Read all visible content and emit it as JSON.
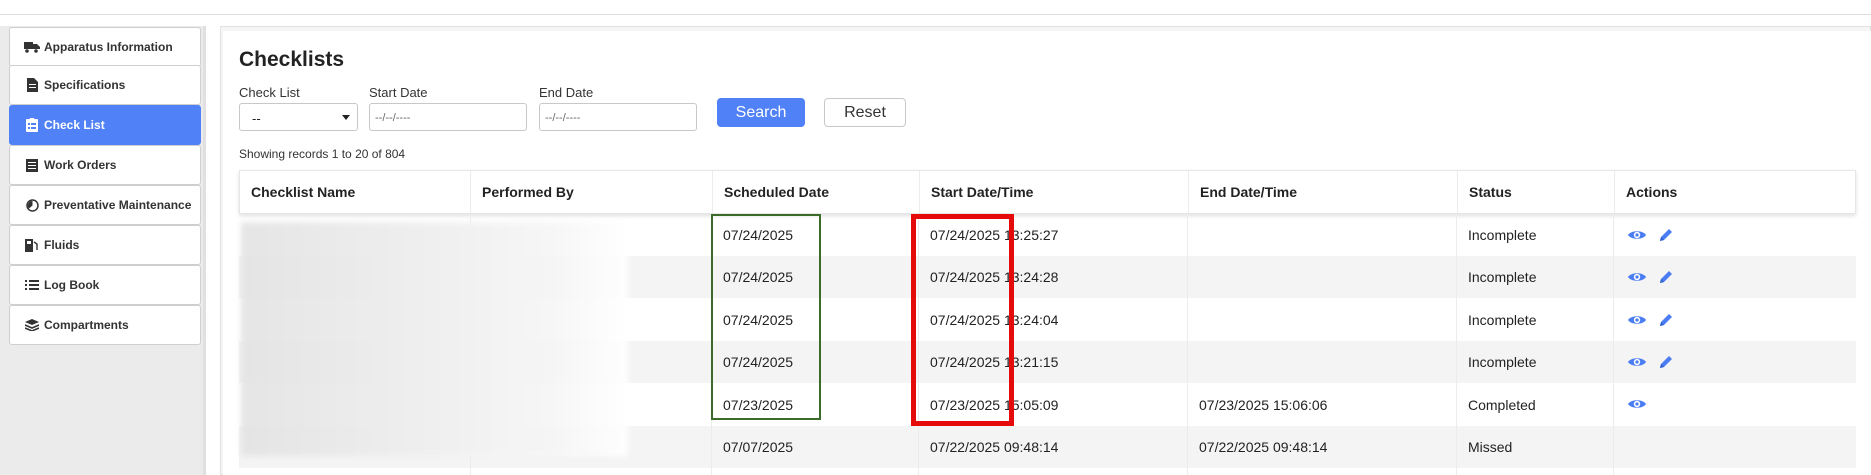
{
  "sidebar": {
    "items": [
      {
        "label": "Apparatus Information",
        "icon": "truck-icon",
        "active": false
      },
      {
        "label": "Specifications",
        "icon": "document-icon",
        "active": false
      },
      {
        "label": "Check List",
        "icon": "clipboard-icon",
        "active": true
      },
      {
        "label": "Work Orders",
        "icon": "list-box-icon",
        "active": false
      },
      {
        "label": "Preventative Maintenance",
        "icon": "gauge-icon",
        "active": false
      },
      {
        "label": "Fluids",
        "icon": "fuel-icon",
        "active": false
      },
      {
        "label": "Log Book",
        "icon": "list-icon",
        "active": false
      },
      {
        "label": "Compartments",
        "icon": "layers-icon",
        "active": false
      }
    ]
  },
  "main": {
    "title": "Checklists",
    "filters": {
      "checklist_label": "Check List",
      "checklist_value": "--",
      "start_label": "Start Date",
      "start_placeholder": "--/--/----",
      "end_label": "End Date",
      "end_placeholder": "--/--/----"
    },
    "search_label": "Search",
    "reset_label": "Reset",
    "records_text": "Showing records 1 to 20 of 804",
    "table": {
      "columns": [
        "Checklist Name",
        "Performed By",
        "Scheduled Date",
        "Start Date/Time",
        "End Date/Time",
        "Status",
        "Actions"
      ],
      "rows": [
        {
          "name": "",
          "performed_by": "",
          "scheduled": "07/24/2025",
          "start": "07/24/2025 13:25:27",
          "end": "",
          "status": "Incomplete",
          "actions": [
            "view-icon",
            "edit-icon"
          ]
        },
        {
          "name": "",
          "performed_by": "",
          "scheduled": "07/24/2025",
          "start": "07/24/2025 13:24:28",
          "end": "",
          "status": "Incomplete",
          "actions": [
            "view-icon",
            "edit-icon"
          ]
        },
        {
          "name": "",
          "performed_by": "",
          "scheduled": "07/24/2025",
          "start": "07/24/2025 13:24:04",
          "end": "",
          "status": "Incomplete",
          "actions": [
            "view-icon",
            "edit-icon"
          ]
        },
        {
          "name": "",
          "performed_by": "",
          "scheduled": "07/24/2025",
          "start": "07/24/2025 13:21:15",
          "end": "",
          "status": "Incomplete",
          "actions": [
            "view-icon",
            "edit-icon"
          ]
        },
        {
          "name": "",
          "performed_by": "",
          "scheduled": "07/23/2025",
          "start": "07/23/2025 15:05:09",
          "end": "07/23/2025 15:06:06",
          "status": "Completed",
          "actions": [
            "view-icon"
          ]
        },
        {
          "name": "",
          "performed_by": "",
          "scheduled": "07/07/2025",
          "start": "07/22/2025 09:48:14",
          "end": "07/22/2025 09:48:14",
          "status": "Missed",
          "actions": []
        }
      ]
    }
  },
  "colors": {
    "accent": "#5181f6",
    "highlight_green": "#3a6b28",
    "highlight_red": "#e50b0b"
  }
}
